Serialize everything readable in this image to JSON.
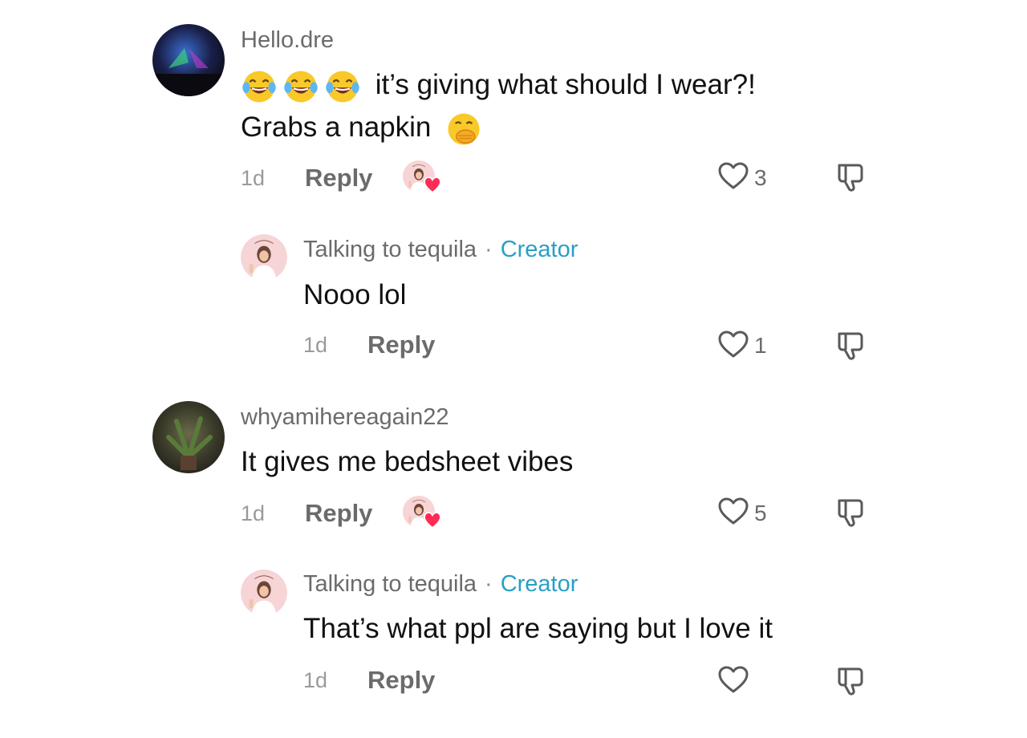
{
  "comments": [
    {
      "username": "Hello.dre",
      "text_line1": "it’s giving what should I wear?!",
      "text_line2": "Grabs a napkin",
      "emoji_line1": [
        "face-with-tears-of-joy",
        "face-with-tears-of-joy",
        "face-with-tears-of-joy"
      ],
      "emoji_line2": "face-with-hand-over-mouth",
      "time": "1d",
      "reply_label": "Reply",
      "likes": "3",
      "creator_liked": true
    },
    {
      "username": "Talking to tequila",
      "badge": "Creator",
      "text": "Nooo lol",
      "time": "1d",
      "reply_label": "Reply",
      "likes": "1",
      "is_reply": true
    },
    {
      "username": "whyamihereagain22",
      "text": "It gives me bedsheet vibes",
      "time": "1d",
      "reply_label": "Reply",
      "likes": "5",
      "creator_liked": true
    },
    {
      "username": "Talking to tequila",
      "badge": "Creator",
      "text": "That’s what ppl are saying but I love it",
      "time": "1d",
      "reply_label": "Reply",
      "likes": "",
      "is_reply": true
    }
  ],
  "separator": "·",
  "colors": {
    "creator_badge": "#2a9fc4",
    "heart_red": "#fe2c55",
    "username_gray": "#6b6b6b"
  }
}
